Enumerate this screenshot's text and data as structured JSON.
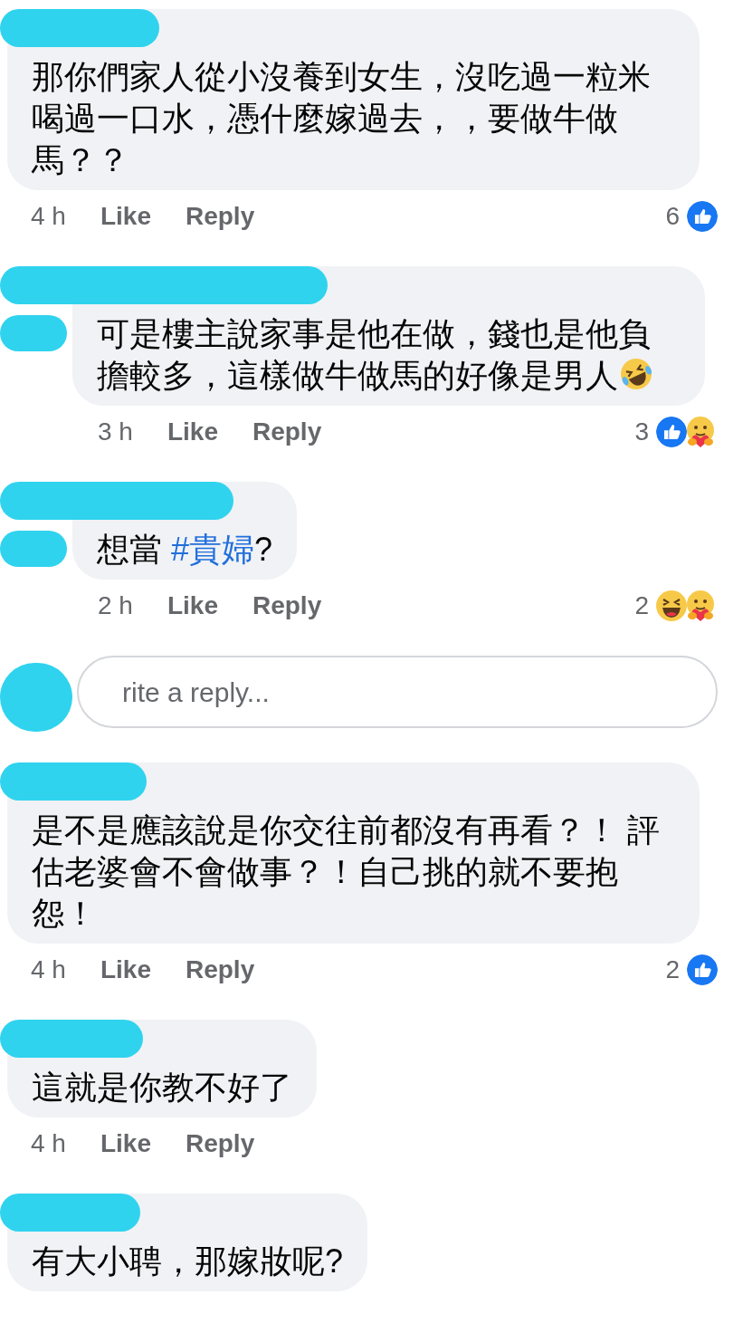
{
  "comments": [
    {
      "kind": "comment",
      "segments": [
        {
          "kind": "text",
          "text": "那你們家人從小沒養到女生，沒吃過一粒米喝過一口水，憑什麼嫁過去，，要做牛做馬？？"
        }
      ],
      "time": "4 h",
      "like": "Like",
      "reply": "Reply",
      "reaction_count": "6",
      "reactions": [
        {
          "kind": "like"
        }
      ]
    },
    {
      "kind": "reply",
      "segments": [
        {
          "kind": "text",
          "text": "可是樓主說家事是他在做，錢也是他負擔較多，這樣做牛做馬的好像是男人"
        },
        {
          "kind": "emoji"
        }
      ],
      "time": "3 h",
      "like": "Like",
      "reply": "Reply",
      "reaction_count": "3",
      "reactions": [
        {
          "kind": "like"
        },
        {
          "kind": "care"
        }
      ]
    },
    {
      "kind": "reply",
      "segments": [
        {
          "kind": "text",
          "text": "想當 "
        },
        {
          "kind": "hashtag",
          "text": "#貴婦"
        },
        {
          "kind": "text",
          "text": "?"
        }
      ],
      "time": "2 h",
      "like": "Like",
      "reply": "Reply",
      "reaction_count": "2",
      "reactions": [
        {
          "kind": "haha"
        },
        {
          "kind": "care"
        }
      ]
    },
    {
      "kind": "field",
      "placeholder": "rite a reply..."
    },
    {
      "kind": "comment",
      "segments": [
        {
          "kind": "text",
          "text": "是不是應該說是你交往前都沒有再看？！ 評估老婆會不會做事？！自己挑的就不要抱怨！"
        }
      ],
      "time": "4 h",
      "like": "Like",
      "reply": "Reply",
      "reaction_count": "2",
      "reactions": [
        {
          "kind": "like"
        }
      ]
    },
    {
      "kind": "comment",
      "segments": [
        {
          "kind": "text",
          "text": "這就是你教不好了"
        }
      ],
      "time": "4 h",
      "like": "Like",
      "reply": "Reply"
    },
    {
      "kind": "comment",
      "segments": [
        {
          "kind": "text",
          "text": "有大小聘，那嫁妝呢?"
        }
      ]
    }
  ]
}
